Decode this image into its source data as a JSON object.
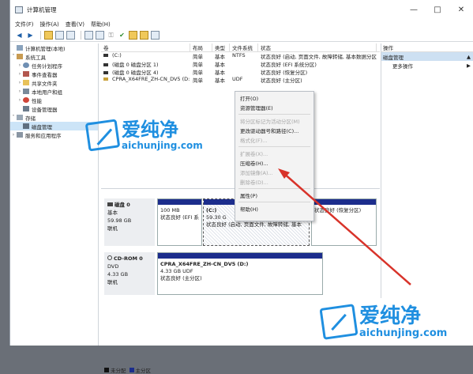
{
  "window": {
    "title": "计算机管理",
    "controls": [
      "—",
      "□",
      "✕"
    ]
  },
  "menu": [
    "文件(F)",
    "操作(A)",
    "查看(V)",
    "帮助(H)"
  ],
  "tree": [
    {
      "label": "计算机管理(本地)",
      "indent": 0,
      "chev": "",
      "icon": "computer-icon"
    },
    {
      "label": "系统工具",
      "indent": 1,
      "chev": "˅",
      "icon": "tools-icon"
    },
    {
      "label": "任务计划程序",
      "indent": 2,
      "chev": "›",
      "icon": "clock-icon"
    },
    {
      "label": "事件查看器",
      "indent": 2,
      "chev": "›",
      "icon": "event-icon"
    },
    {
      "label": "共享文件夹",
      "indent": 2,
      "chev": "›",
      "icon": "folder-icon"
    },
    {
      "label": "本地用户和组",
      "indent": 2,
      "chev": "›",
      "icon": "users-icon"
    },
    {
      "label": "性能",
      "indent": 2,
      "chev": "›",
      "icon": "performance-icon"
    },
    {
      "label": "设备管理器",
      "indent": 2,
      "chev": "",
      "icon": "device-icon"
    },
    {
      "label": "存储",
      "indent": 1,
      "chev": "˅",
      "icon": "storage-icon"
    },
    {
      "label": "磁盘管理",
      "indent": 2,
      "chev": "",
      "icon": "disk-icon",
      "selected": true
    },
    {
      "label": "服务和应用程序",
      "indent": 1,
      "chev": "›",
      "icon": "services-icon"
    }
  ],
  "columns": [
    "卷",
    "布局",
    "类型",
    "文件系统",
    "状态"
  ],
  "volumes": [
    {
      "name": "(C:)",
      "layout": "简单",
      "type": "基本",
      "fs": "NTFS",
      "status": "状态良好 (启动, 页面文件, 故障转储, 基本数据分区)"
    },
    {
      "name": "(磁盘 0 磁盘分区 1)",
      "layout": "简单",
      "type": "基本",
      "fs": "",
      "status": "状态良好 (EFI 系统分区)"
    },
    {
      "name": "(磁盘 0 磁盘分区 4)",
      "layout": "简单",
      "type": "基本",
      "fs": "",
      "status": "状态良好 (恢复分区)"
    },
    {
      "name": "CPRA_X64FRE_ZH-CN_DV5 (D:)",
      "layout": "简单",
      "type": "基本",
      "fs": "UDF",
      "status": "状态良好 (主分区)"
    }
  ],
  "context_menu": [
    {
      "label": "打开(O)",
      "disabled": false
    },
    {
      "label": "资源管理器(E)",
      "disabled": false
    },
    {
      "sep": true
    },
    {
      "label": "将分区标记为活动分区(M)",
      "disabled": true
    },
    {
      "label": "更改驱动器号和路径(C)...",
      "disabled": false
    },
    {
      "label": "格式化(F)...",
      "disabled": true
    },
    {
      "sep": true
    },
    {
      "label": "扩展卷(X)...",
      "disabled": true
    },
    {
      "label": "压缩卷(H)...",
      "disabled": false
    },
    {
      "label": "添加镜像(A)...",
      "disabled": true
    },
    {
      "label": "删除卷(D)...",
      "disabled": true
    },
    {
      "sep": true
    },
    {
      "label": "属性(P)",
      "disabled": false
    },
    {
      "sep": true
    },
    {
      "label": "帮助(H)",
      "disabled": false
    }
  ],
  "disks": {
    "disk0": {
      "name": "磁盘 0",
      "type": "基本",
      "size": "59.98 GB",
      "state": "联机"
    },
    "cdrom0": {
      "name": "CD-ROM 0",
      "type": "DVD",
      "size": "4.33 GB",
      "state": "联机"
    }
  },
  "partitions": {
    "p1": {
      "line1": "",
      "line2": "100 MB",
      "line3": "状态良好 (EFI 系"
    },
    "p2": {
      "line1": "(C:)",
      "line2": "59.30 G",
      "line3": "状态良好 (启动, 页面文件, 故障转储, 基本"
    },
    "p3": {
      "line1": "",
      "line2": "",
      "line3": "状态良好 (恢复分区)"
    },
    "cd": {
      "line1": "CPRA_X64FRE_ZH-CN_DV5  (D:)",
      "line2": "4.33 GB UDF",
      "line3": "状态良好 (主分区)"
    }
  },
  "legend": {
    "unallocated": "未分配",
    "primary": "主分区"
  },
  "actions": {
    "header": "操作",
    "selected": "磁盘管理",
    "more": "更多操作"
  },
  "watermark": {
    "cn": "爱纯净",
    "url": "aichunjing.com"
  },
  "colors": {
    "partition_bar": "#1c2d8c",
    "selection": "#cce4f7",
    "accent": "#1f8fe0",
    "arrow": "#d8332a"
  }
}
